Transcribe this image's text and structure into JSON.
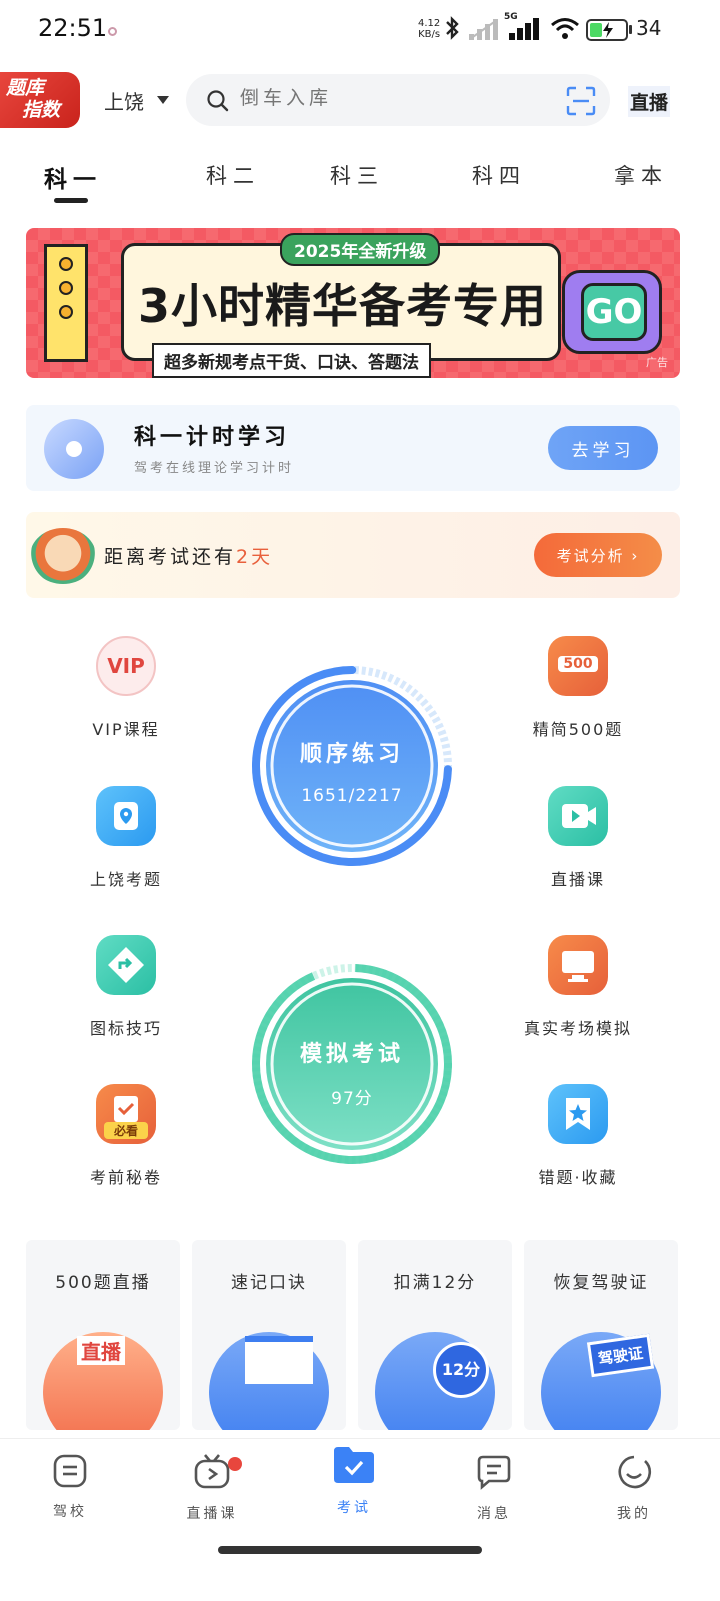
{
  "status_bar": {
    "time": "22:51",
    "net_speed_value": "4.12",
    "net_speed_unit": "KB/s",
    "signal_label": "5G",
    "battery_percent": "34",
    "battery_level": 0.34
  },
  "header": {
    "badge_line1": "题库",
    "badge_line2": "指数",
    "city": "上饶",
    "search_placeholder": "倒车入库",
    "live_label": "直播"
  },
  "tabs": [
    {
      "label": "科一"
    },
    {
      "label": "科二"
    },
    {
      "label": "科三"
    },
    {
      "label": "科四"
    },
    {
      "label": "拿本"
    }
  ],
  "banner": {
    "tag": "2025年全新升级",
    "title": "3小时精华备考专用",
    "subtitle": "超多新规考点干货、口诀、答题法",
    "go_label": "GO",
    "ad_label": "广告"
  },
  "timer_card": {
    "title": "科一计时学习",
    "subtitle": "驾考在线理论学习计时",
    "button": "去学习"
  },
  "countdown": {
    "prefix": "距离考试还有",
    "days": "2天",
    "button": "考试分析"
  },
  "grid_left": [
    {
      "label": "VIP课程",
      "icon": "vip-icon",
      "icon_text": "VIP"
    },
    {
      "label": "上饶考题",
      "icon": "location-icon"
    },
    {
      "label": "图标技巧",
      "icon": "sign-icon"
    },
    {
      "label": "考前秘卷",
      "icon": "exam-paper-icon",
      "icon_text": "必看"
    }
  ],
  "grid_right": [
    {
      "label": "精简500题",
      "icon": "500-icon",
      "icon_text": "500"
    },
    {
      "label": "直播课",
      "icon": "video-icon"
    },
    {
      "label": "真实考场模拟",
      "icon": "monitor-icon"
    },
    {
      "label": "错题·收藏",
      "icon": "star-bookmark-icon"
    }
  ],
  "practice_circle": {
    "title": "顺序练习",
    "progress": "1651/2217",
    "done": 1651,
    "total": 2217
  },
  "exam_circle": {
    "title": "模拟考试",
    "score": "97分"
  },
  "bottom_cards": [
    {
      "title": "500题直播",
      "art_text": "直播"
    },
    {
      "title": "速记口诀"
    },
    {
      "title": "扣满12分",
      "art_text": "12分"
    },
    {
      "title": "恢复驾驶证",
      "art_text": "驾驶证"
    }
  ],
  "bottom_nav": [
    {
      "label": "驾校",
      "icon": "school-icon"
    },
    {
      "label": "直播课",
      "icon": "tv-icon"
    },
    {
      "label": "考试",
      "icon": "exam-folder-icon",
      "active": true
    },
    {
      "label": "消息",
      "icon": "message-icon"
    },
    {
      "label": "我的",
      "icon": "profile-icon"
    }
  ],
  "colors": {
    "accent_blue": "#3b82f6",
    "practice_gradient": [
      "#4f8ff4",
      "#6fb3f8"
    ],
    "exam_gradient": [
      "#3fc4a0",
      "#7ee0c6"
    ],
    "countdown_orange": "#f46a3a",
    "badge_red": "#e8463d"
  }
}
